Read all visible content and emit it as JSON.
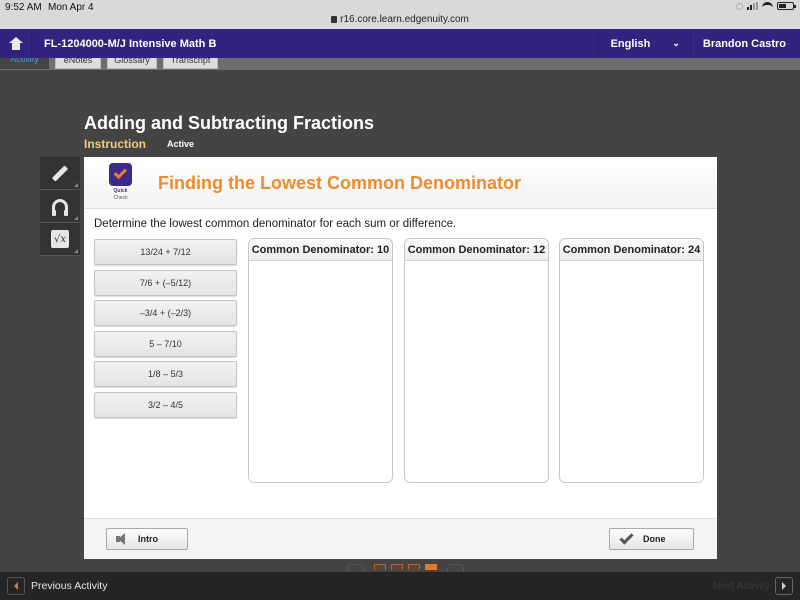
{
  "status_bar": {
    "time": "9:52 AM",
    "date": "Mon Apr 4",
    "url": "r16.core.learn.edgenuity.com"
  },
  "header": {
    "course_title": "FL-1204000-M/J Intensive Math B",
    "language": "English",
    "user_name": "Brandon Castro"
  },
  "tabs": [
    {
      "label": "Activity"
    },
    {
      "label": "eNotes"
    },
    {
      "label": "Glossary"
    },
    {
      "label": "Transcript"
    }
  ],
  "lesson": {
    "title": "Adding and Subtracting Fractions",
    "section": "Instruction",
    "status": "Active"
  },
  "tools": [
    "pencil-icon",
    "headphones-icon",
    "calculator-icon"
  ],
  "activity": {
    "badge_line1": "Quick",
    "badge_line2": "Check",
    "title": "Finding the Lowest Common Denominator",
    "instruction": "Determine the lowest common denominator for each sum or difference.",
    "items": [
      "13/24 + 7/12",
      "7/6 + (–5/12)",
      "–3/4 + (–2/3)",
      "5 – 7/10",
      "1/8 – 5/3",
      "3/2 – 4/5"
    ],
    "bins": [
      {
        "label": "Common Denominator: 10"
      },
      {
        "label": "Common Denominator: 12"
      },
      {
        "label": "Common Denominator: 24"
      }
    ],
    "intro_button": "Intro",
    "done_button": "Done"
  },
  "pager": {
    "pages": 4,
    "current": 4
  },
  "footer": {
    "previous": "Previous Activity",
    "next": "Next Activity"
  }
}
